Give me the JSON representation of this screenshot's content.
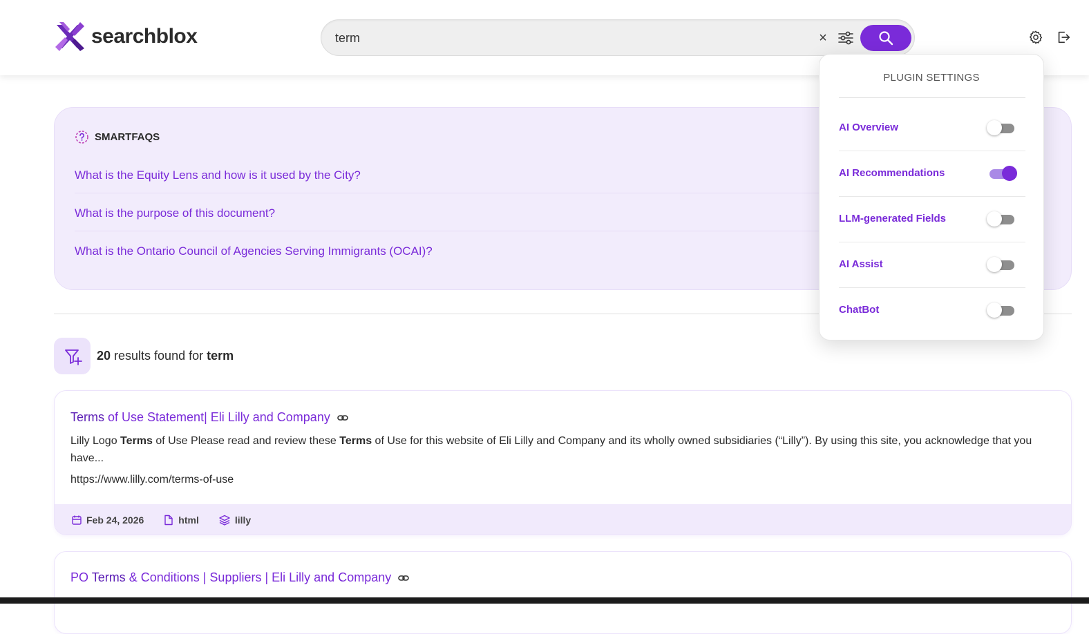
{
  "brand": {
    "name": "searchblox",
    "accent": "#7a2bd9"
  },
  "search": {
    "query": "term",
    "clear_label": "×"
  },
  "smartfaqs": {
    "heading": "SMARTFAQS",
    "items": [
      "What is the Equity Lens and how is it used by the City?",
      "What is the purpose of this document?",
      "What is the Ontario Council of Agencies Serving Immigrants (OCAI)?"
    ]
  },
  "results": {
    "count": "20",
    "middle_text": " results found for ",
    "term": "term",
    "items": [
      {
        "title_bold": "Terms",
        "title_rest": " of Use Statement| Eli Lilly and Company",
        "desc": [
          "Lilly Logo ",
          "Terms",
          " of Use Please read and review these ",
          "Terms",
          " of Use for this website of Eli Lilly and Company and its wholly owned subsidiaries (“Lilly”). By using this site, you acknowledge that you have..."
        ],
        "url": "https://www.lilly.com/terms-of-use",
        "date": "Feb 24, 2026",
        "type": "html",
        "collection": "lilly"
      },
      {
        "title_pre": "PO ",
        "title_bold": "Terms",
        "title_rest": " & Conditions | Suppliers | Eli Lilly and Company"
      }
    ]
  },
  "plugin_settings": {
    "title": "PLUGIN SETTINGS",
    "items": [
      {
        "label": "AI Overview",
        "enabled": false
      },
      {
        "label": "AI Recommendations",
        "enabled": true
      },
      {
        "label": "LLM-generated Fields",
        "enabled": false
      },
      {
        "label": "AI Assist",
        "enabled": false
      },
      {
        "label": "ChatBot",
        "enabled": false
      }
    ]
  }
}
